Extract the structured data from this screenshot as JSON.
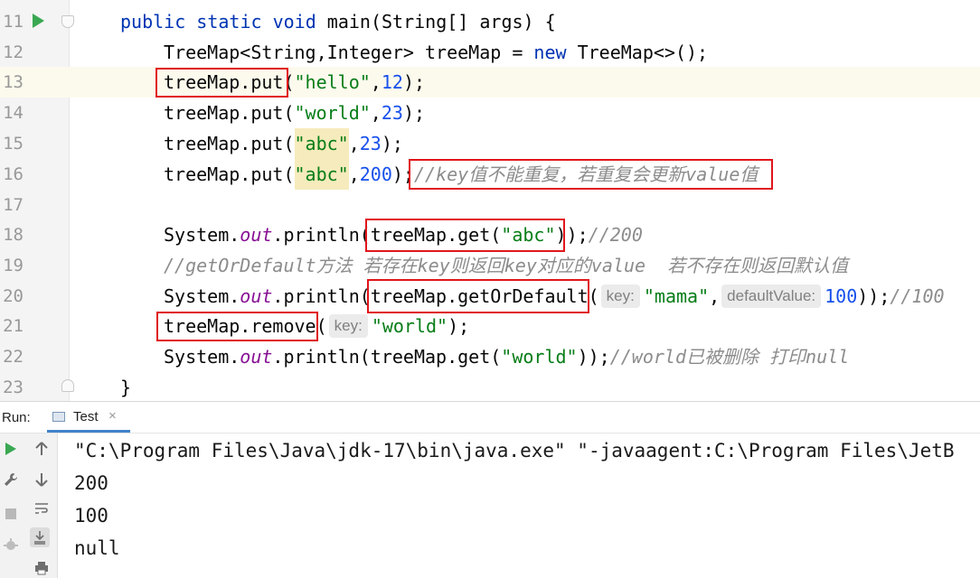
{
  "editor": {
    "lines": [
      {
        "num": "11"
      },
      {
        "num": "12"
      },
      {
        "num": "13"
      },
      {
        "num": "14"
      },
      {
        "num": "15"
      },
      {
        "num": "16"
      },
      {
        "num": "17"
      },
      {
        "num": "18"
      },
      {
        "num": "19"
      },
      {
        "num": "20"
      },
      {
        "num": "21"
      },
      {
        "num": "22"
      },
      {
        "num": "23"
      }
    ],
    "code": {
      "l11": {
        "kw1": "public static void ",
        "name": "main(String[] args) {"
      },
      "l12": {
        "t1": "TreeMap<String,Integer> treeMap = ",
        "kw": "new",
        "t2": " TreeMap<>();"
      },
      "l13": {
        "call": "treeMap.put",
        "p1": "(",
        "s": "\"hello\"",
        "c": ",",
        "n": "12",
        "end": ");"
      },
      "l14": {
        "call": "treeMap.put(",
        "s": "\"world\"",
        "c": ",",
        "n": "23",
        "end": ");"
      },
      "l15": {
        "call": "treeMap.put(",
        "s": "\"abc\"",
        "c": ",",
        "n": "23",
        "end": ");"
      },
      "l16": {
        "call": "treeMap.put(",
        "s": "\"abc\"",
        "c": ",",
        "n": "200",
        "end": ");",
        "comment": "//key值不能重复，若重复会更新value值"
      },
      "l18": {
        "t1": "System.",
        "fld": "out",
        "t2": ".println(",
        "call": "treeMap.get(",
        "s": "\"abc\"",
        "p": ")",
        "end": ");",
        "comment": "//200"
      },
      "l19": {
        "comment": "//getOrDefault方法 若存在key则返回key对应的value  若不存在则返回默认值"
      },
      "l20": {
        "t1": "System.",
        "fld": "out",
        "t2": ".println(",
        "call": "treeMap.getOrDefault",
        "p": "(",
        "hint1": "key:",
        "s": "\"mama\"",
        "c": ",",
        "hint2": "defaultValue:",
        "n": "100",
        "end": "));",
        "comment": "//100"
      },
      "l21": {
        "call": "treeMap.remove",
        "p": "(",
        "hint": "key:",
        "s": "\"world\"",
        "end": ");"
      },
      "l22": {
        "t1": "System.",
        "fld": "out",
        "t2": ".println(treeMap.get(",
        "s": "\"world\"",
        "end": "));",
        "comment": "//world已被删除 打印null"
      },
      "l23": {
        "t": "}"
      }
    }
  },
  "run_panel": {
    "label": "Run:",
    "tab": {
      "label": "Test",
      "close": "×"
    },
    "output": [
      "\"C:\\Program Files\\Java\\jdk-17\\bin\\java.exe\" \"-javaagent:C:\\Program Files\\JetB",
      "200",
      "100",
      "null"
    ],
    "tools": [
      "play-icon",
      "wrench-icon",
      "stop-icon",
      "debug-icon",
      "up-arrow-icon",
      "down-arrow-icon",
      "soft-wrap-icon",
      "scroll-to-end-icon",
      "print-icon"
    ]
  }
}
